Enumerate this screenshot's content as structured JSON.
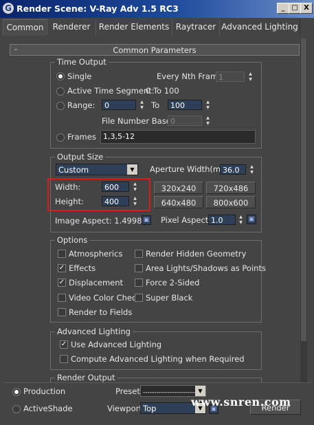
{
  "window": {
    "title": "Render Scene: V-Ray Adv 1.5 RC3",
    "icon_letter": "G",
    "controls": [
      "_",
      "□",
      "X"
    ]
  },
  "tabs": [
    "Common",
    "Renderer",
    "Render Elements",
    "Raytracer",
    "Advanced Lighting"
  ],
  "rollout": {
    "toggle": "-",
    "title": "Common Parameters"
  },
  "time_output": {
    "title": "Time Output",
    "single": "Single",
    "every_nth_label": "Every Nth Frame:",
    "every_nth_value": "1",
    "active_segment": "Active Time Segment:",
    "active_segment_value": "0 To 100",
    "range": "Range:",
    "range_from": "0",
    "to_label": "To",
    "range_to": "100",
    "file_number_base_label": "File Number Base:",
    "file_number_base_value": "0",
    "frames": "Frames",
    "frames_value": "1,3,5-12"
  },
  "output_size": {
    "title": "Output Size",
    "preset": "Custom",
    "aperture_label": "Aperture Width(mm):",
    "aperture_value": "36.0",
    "width_label": "Width:",
    "width_value": "600",
    "height_label": "Height:",
    "height_value": "400",
    "presets": [
      "320x240",
      "720x486",
      "640x480",
      "800x600"
    ],
    "image_aspect": "Image Aspect: 1.49981",
    "pixel_aspect_label": "Pixel Aspect:",
    "pixel_aspect_value": "1.0"
  },
  "options": {
    "title": "Options",
    "items": [
      {
        "label": "Atmospherics",
        "checked": false
      },
      {
        "label": "Render Hidden Geometry",
        "checked": false
      },
      {
        "label": "Effects",
        "checked": true
      },
      {
        "label": "Area Lights/Shadows as Points",
        "checked": false
      },
      {
        "label": "Displacement",
        "checked": true
      },
      {
        "label": "Force 2-Sided",
        "checked": false
      },
      {
        "label": "Video Color Check",
        "checked": false
      },
      {
        "label": "Super Black",
        "checked": false
      },
      {
        "label": "Render to Fields",
        "checked": false
      }
    ]
  },
  "advanced_lighting": {
    "title": "Advanced Lighting",
    "use": "Use Advanced Lighting",
    "compute": "Compute Advanced Lighting when Required"
  },
  "render_output": {
    "title": "Render Output"
  },
  "bottom": {
    "production": "Production",
    "activeshade": "ActiveShade",
    "preset_label": "Preset:",
    "preset_value": "-------------------------",
    "viewport_label": "Viewport:",
    "viewport_value": "Top",
    "render_button": "Render"
  },
  "watermark": "www.snren.com"
}
